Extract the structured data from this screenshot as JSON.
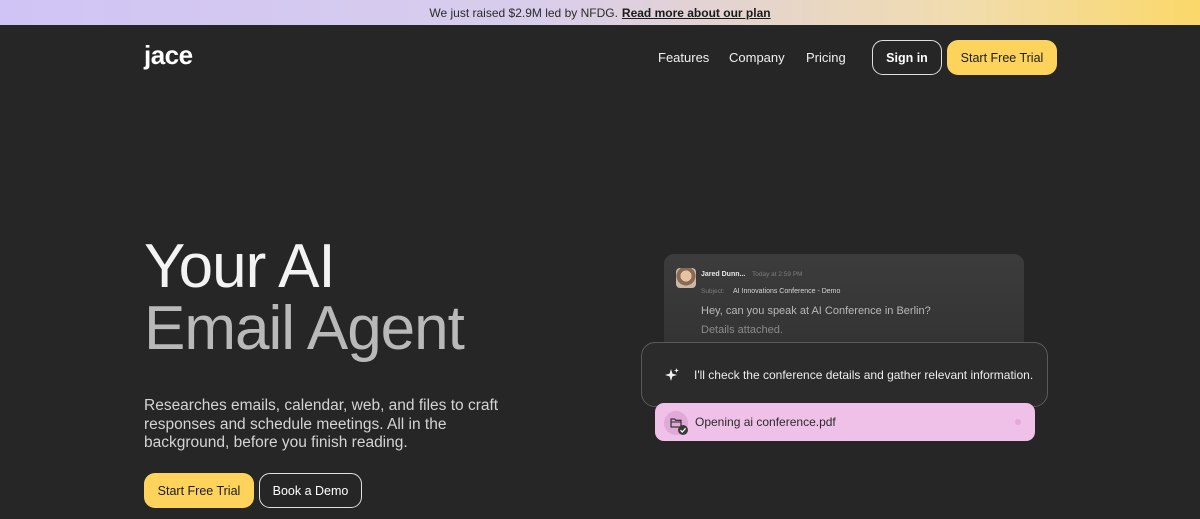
{
  "banner": {
    "text": "We just raised $2.9M led by NFDG.",
    "link": "Read more about our plan"
  },
  "header": {
    "logo": "jace",
    "nav": [
      "Features",
      "Company",
      "Pricing"
    ],
    "signin": "Sign in",
    "cta": "Start Free Trial"
  },
  "hero": {
    "title_line1": "Your AI",
    "title_line2": "Email Agent",
    "subtitle": "Researches emails, calendar, web, and files to craft responses and schedule meetings. All in the background, before you finish reading.",
    "cta_primary": "Start Free Trial",
    "cta_secondary": "Book a Demo"
  },
  "demo": {
    "email": {
      "sender": "Jared Dunn...",
      "time": "Today at 2:59 PM",
      "subject_label": "Subject:",
      "subject": "AI Innovations Conference - Demo",
      "body_line1": "Hey, can you speak at AI Conference in Berlin?",
      "body_line2": "Details attached."
    },
    "agent_message": "I'll check the conference details and gather relevant information.",
    "file_action": "Opening ai conference.pdf"
  },
  "colors": {
    "background": "#262626",
    "accent_yellow": "#fdd35c",
    "file_pink": "#efc1e8"
  },
  "icons": {
    "sparkle": "sparkle-icon",
    "folder": "folder-icon",
    "check": "check-icon"
  }
}
